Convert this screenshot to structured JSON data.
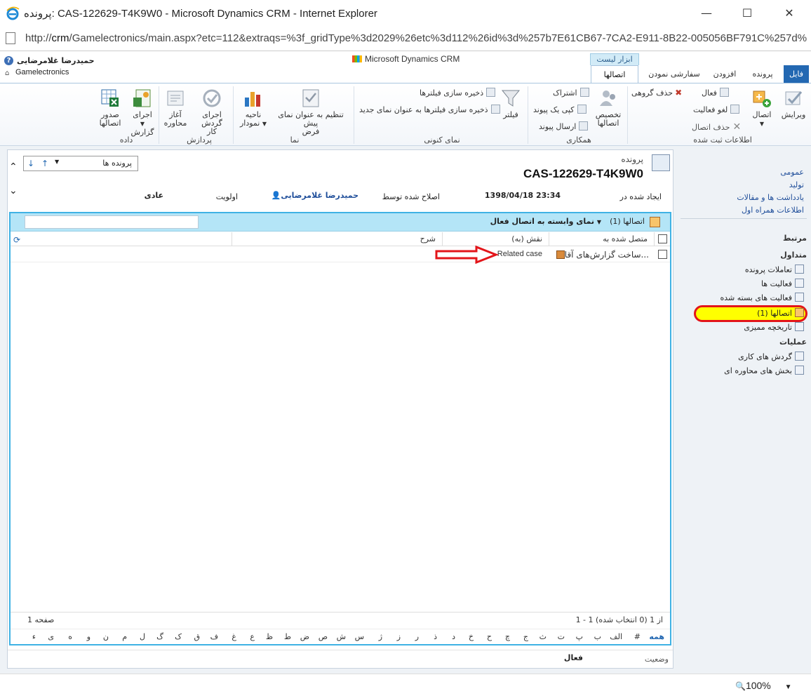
{
  "window": {
    "title": "پرونده: CAS-122629-T4K9W0 - Microsoft Dynamics CRM - Internet Explorer",
    "url_host": "crm",
    "url_prefix": "http://",
    "url_rest": "/Gamelectronics/main.aspx?etc=112&extraqs=%3f_gridType%3d2029%26etc%3d112%26id%3d%257b7E61CB67-7CA2-E911-8B22-005056BF791C%257d%26p"
  },
  "header": {
    "user_name": "حمیدرضا غلامرضایی",
    "org_name": "Gamelectronics",
    "product": "Microsoft Dynamics CRM",
    "context_tab": "ابزار لیست"
  },
  "tabs": {
    "file": "فایل",
    "case": "پرونده",
    "addins": "افزودن",
    "customize": "سفارشی نمودن",
    "connections": "اتصالها"
  },
  "ribbon": {
    "record_group": {
      "label": "اطلاعات ثبت شده",
      "edit": "ویرایش",
      "connect": "اتصال",
      "activate": "فعال",
      "deactivate": "لغو فعالیت",
      "delete_connection": "حذف اتصال",
      "bulk_delete": "حذف گروهی"
    },
    "collab_group": {
      "label": "همکاری",
      "assign_l1": "تخصیص",
      "assign_l2": "اتصالها",
      "share": "اشتراک",
      "copy_link": "کپی یک پیوند",
      "send_link": "ارسال پیوند"
    },
    "view_group": {
      "label": "نمای کنونی",
      "filter": "فیلتر",
      "save_filters": "ذخیره سازی فیلترها",
      "save_filters_new": "ذخیره سازی فیلترها به عنوان نمای جدید"
    },
    "display_group": {
      "label": "نما",
      "set_default_l1": "تنظیم به عنوان نمای پیش",
      "set_default_l2": "فرض",
      "chart_l1": "ناحیه",
      "chart_l2": "نمودار"
    },
    "process_group": {
      "label": "پردازش",
      "run_workflow_l1": "اجرای گردش",
      "run_workflow_l2": "کار",
      "start_dialog_l1": "آغاز",
      "start_dialog_l2": "محاوره"
    },
    "data_group": {
      "label": "داده",
      "run_report_l1": "اجرای",
      "run_report_l2": "گزارش",
      "export_l1": "صدور",
      "export_l2": "اتصالها"
    }
  },
  "form": {
    "record_type": "پرونده",
    "record_title": "CAS-122629-T4K9W0",
    "created_on_label": "ایجاد شده در",
    "created_on_value": "1398/04/18 23:34",
    "modified_by_label": "اصلاح شده توسط",
    "modified_by_value": "حمیدرضا غلامرضایی",
    "priority_label": "اولویت",
    "priority_value": "عادی",
    "nav_label": "پرونده ها"
  },
  "grid": {
    "count_label": "اتصالها (1)",
    "view_name": "نمای وابسته به اتصال فعال",
    "columns": [
      "متصل شده به",
      "نقش (به)",
      "شرح"
    ],
    "rows": [
      {
        "connected_to": "ساخت گزارش‌های آقا...",
        "role": "Related case",
        "description": ""
      }
    ],
    "record_count": "1 - 1 از 1 (0 انتخاب شده)",
    "page": "صفحه 1",
    "alphabet": [
      "همه",
      "#",
      "الف",
      "ب",
      "پ",
      "ت",
      "ث",
      "ج",
      "چ",
      "ح",
      "خ",
      "د",
      "ذ",
      "ر",
      "ز",
      "ژ",
      "س",
      "ش",
      "ص",
      "ض",
      "ط",
      "ظ",
      "ع",
      "غ",
      "ف",
      "ق",
      "ک",
      "گ",
      "ل",
      "م",
      "ن",
      "و",
      "ه",
      "ی",
      "ء"
    ],
    "status_label": "وضعیت",
    "status_value": "فعال"
  },
  "nav": {
    "links": [
      "عمومی",
      "تولید",
      "یادداشت ها و مقالات",
      "اطلاعات همراه اول"
    ],
    "related": "مرتبط",
    "common": "متداول",
    "common_items": [
      "تعاملات پرونده",
      "فعالیت ها",
      "فعالیت های بسته شده",
      "اتصالها (1)",
      "تاریخچه ممیزی"
    ],
    "processes": "عملیات",
    "process_items": [
      "گردش های کاری",
      "بخش های محاوره ای"
    ]
  },
  "statusbar": {
    "zoom": "100%"
  },
  "colors": {
    "accent": "#2368b2",
    "grid_header": "#b4e5f7",
    "highlight": "#ffff00",
    "annotation": "#e3151a"
  }
}
